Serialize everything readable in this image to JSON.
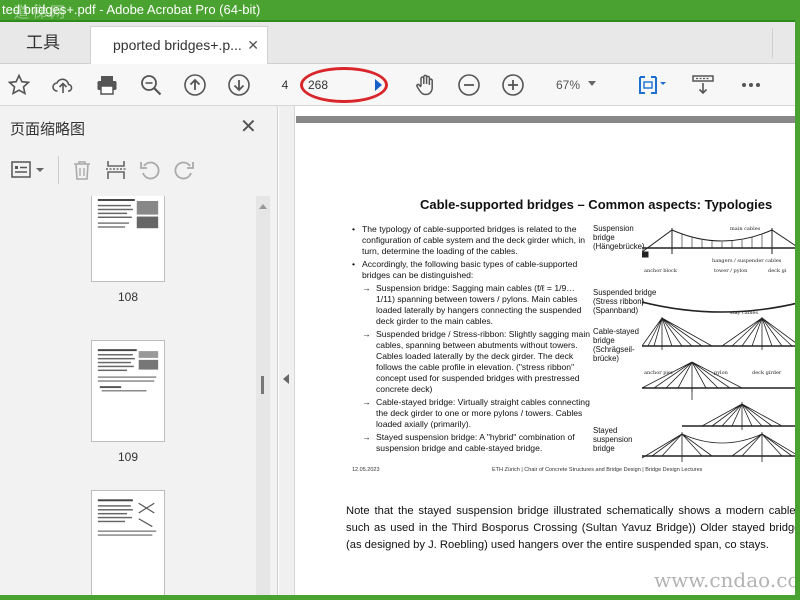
{
  "window": {
    "title": "ted bridges+.pdf - Adobe Acrobat Pro (64-bit)",
    "watermark": "道梯网"
  },
  "tabs": {
    "tools": "工具",
    "document": "pported bridges+.p...",
    "close_glyph": "✕"
  },
  "toolbar": {
    "page_current": "4",
    "page_total": "268",
    "zoom": "67%",
    "icons": [
      "star-icon",
      "cloud-upload-icon",
      "print-icon",
      "search-icon",
      "page-up-icon",
      "page-down-icon",
      "hand-icon",
      "zoom-out-icon",
      "zoom-in-icon",
      "fit-page-icon",
      "scroll-mode-icon",
      "more-icon"
    ]
  },
  "sidebar": {
    "title": "页面缩略图",
    "close_glyph": "✕",
    "thumbnails": [
      {
        "label": "108"
      },
      {
        "label": "109"
      },
      {
        "label": ""
      }
    ]
  },
  "document": {
    "slide_title": "Cable-supported bridges – Common aspects: Typologies",
    "bullets": [
      {
        "marker": "•",
        "text": "The typology of cable-supported bridges is related to the configuration of cable system and the deck girder which, in turn, determine the loading of the cables."
      },
      {
        "marker": "•",
        "text": "Accordingly, the following basic types of cable-supported bridges can be distinguished:"
      }
    ],
    "sub_bullets": [
      {
        "marker": "→",
        "text": "Suspension bridge: Sagging main cables (f/ℓ = 1/9…1/11) spanning between towers / pylons. Main cables loaded laterally by hangers connecting the suspended deck girder to the main cables."
      },
      {
        "marker": "→",
        "text": "Suspended bridge / Stress-ribbon: Slightly sagging main cables, spanning between abutments without towers. Cables loaded laterally by the deck girder. The deck follows the cable profile in elevation. (\"stress ribbon\" concept used for suspended bridges with prestressed concrete deck)"
      },
      {
        "marker": "→",
        "text": "Cable-stayed bridge: Virtually straight cables connecting the deck girder to one or more pylons / towers. Cables loaded axially (primarily)."
      },
      {
        "marker": "→",
        "text": "Stayed suspension bridge: A \"hybrid\" combination of suspension bridge and cable-stayed bridge."
      }
    ],
    "diagram_labels": [
      {
        "text": "Suspension bridge (Hängebrücke)"
      },
      {
        "text": "Suspended bridge (Stress ribbon) (Spannband)"
      },
      {
        "text": "Cable-stayed bridge (Schrägseil-brücke)"
      },
      {
        "text": "Stayed suspension bridge"
      }
    ],
    "diagram_annotations": {
      "main_cables": "main cables",
      "hangers": "hangers / suspender cables",
      "anchor_block": "anchor block",
      "tower": "tower / pylon",
      "deck": "deck gi",
      "stay_cables": "stay cables",
      "anchor_pier": "anchor pier",
      "pylon": "pylon",
      "deck_girder": "deck girder"
    },
    "footer_date": "12.05.2023",
    "footer_inst": "ETH Zürich | Chair of Concrete Structures and Bridge Design | Bridge Design Lectures",
    "body_text": "Note that the stayed suspension bridge illustrated schematically shows a modern cable c such as used in the Third Bosporus Crossing (Sultan Yavuz Bridge)) Older stayed bridges (as designed by J. Roebling) used hangers over the entire suspended span, co stays."
  },
  "site_watermark": "www.cndao.com",
  "colors": {
    "titlebar": "#4aa331",
    "highlight": "#d8262a",
    "page_indicator_arrow": "#1a5fc7",
    "fit_icon": "#1a6fd1"
  }
}
